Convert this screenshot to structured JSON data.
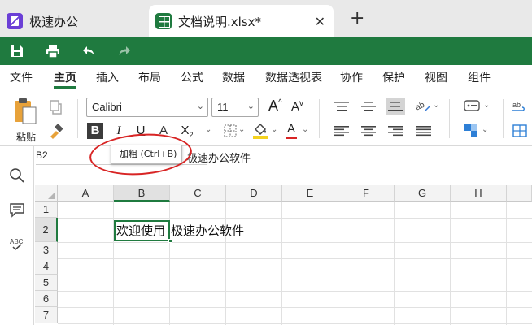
{
  "tabs": [
    {
      "label": "极速办公",
      "icon": "office-logo-icon"
    },
    {
      "label": "文档说明.xlsx*",
      "icon": "spreadsheet-icon",
      "close": "✕"
    }
  ],
  "tab_add": "+",
  "quick_toolbar": {
    "icons": [
      "save-icon",
      "print-icon",
      "undo-icon",
      "redo-icon"
    ]
  },
  "menu": [
    "文件",
    "主页",
    "插入",
    "布局",
    "公式",
    "数据",
    "数据透视表",
    "协作",
    "保护",
    "视图",
    "组件"
  ],
  "menu_active": "主页",
  "ribbon": {
    "paste_label": "粘贴",
    "font_name": "Calibri",
    "font_size": "11",
    "bold": "B",
    "italic": "I",
    "underline": "U",
    "strike": "A",
    "subscript": "X",
    "grow": "A",
    "shrink": "A",
    "font_color": "A",
    "font_color_value": "#d82424"
  },
  "formula_bar": {
    "cell_ref": "B2",
    "content": "极速办公软件"
  },
  "tooltip": "加粗 (Ctrl+B)",
  "sidebar_icons": [
    "search-icon",
    "comment-icon",
    "spellcheck-icon"
  ],
  "columns": [
    "A",
    "B",
    "C",
    "D",
    "E",
    "F",
    "G",
    "H"
  ],
  "rows": [
    "1",
    "2",
    "3",
    "4",
    "5",
    "6",
    "7"
  ],
  "selected_cell": {
    "ref": "B2",
    "text": "欢迎使用"
  },
  "cell_c2": "极速办公软件",
  "colors": {
    "brand": "#1f7a3f",
    "annotation": "#d82424"
  }
}
